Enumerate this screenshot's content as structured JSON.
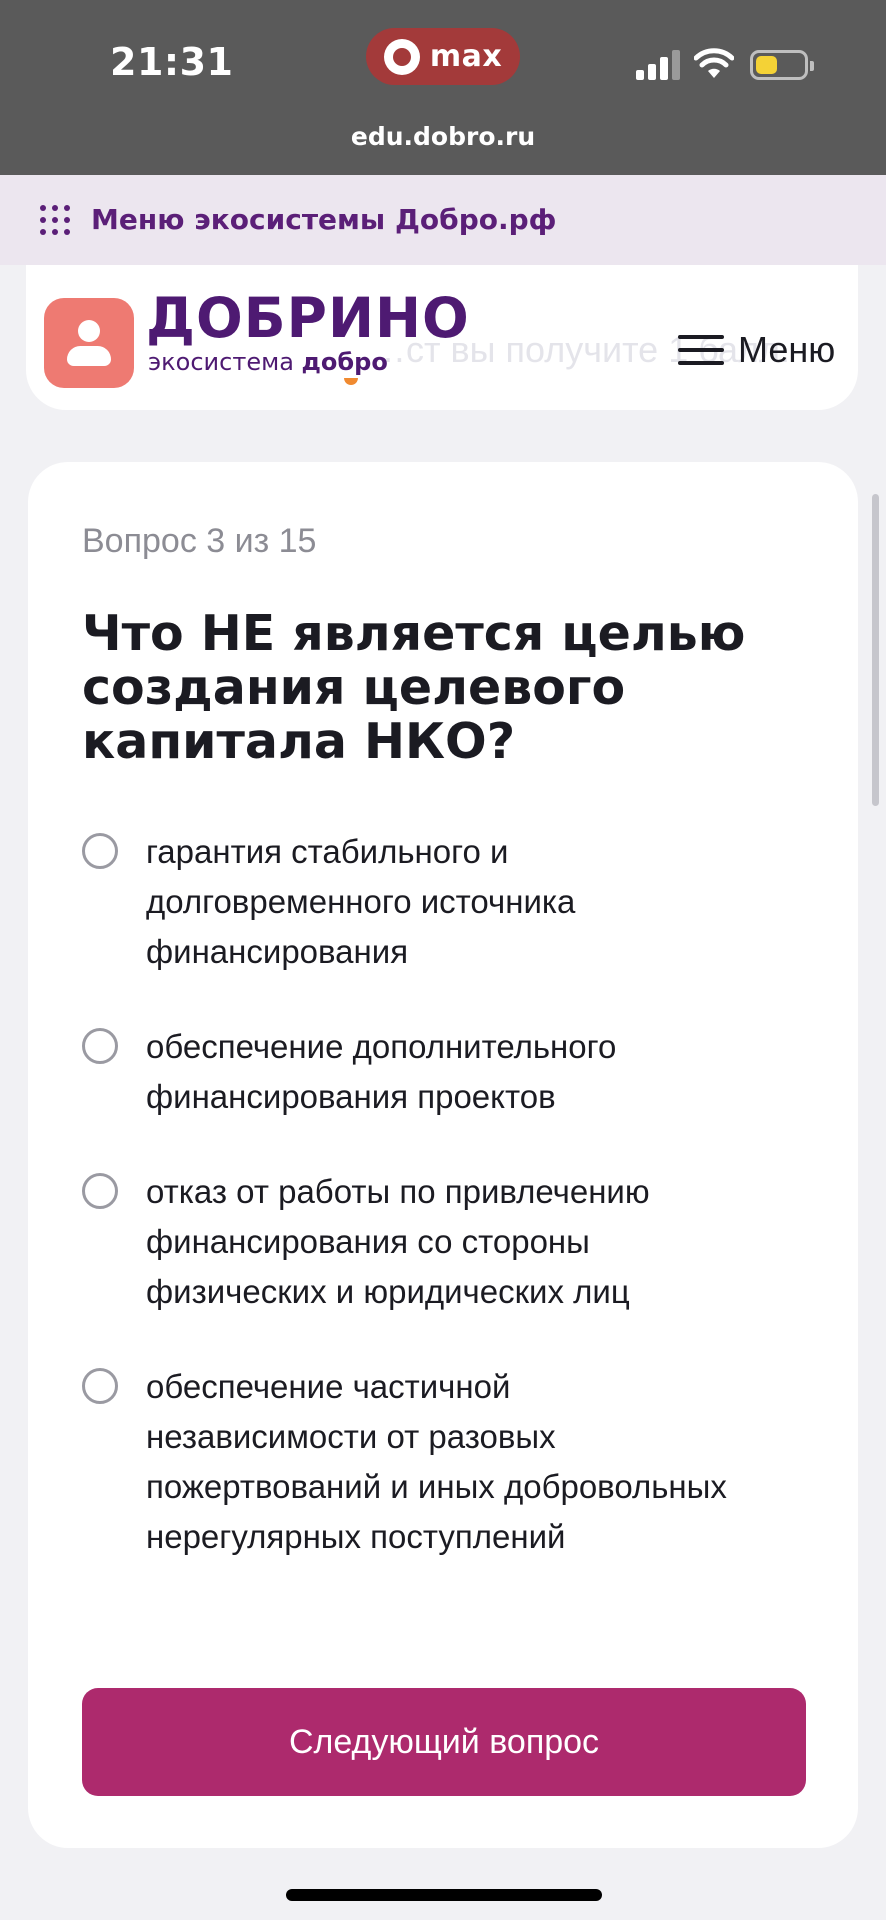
{
  "status_bar": {
    "time": "21:31",
    "messenger_app": "max",
    "url": "edu.dobro.ru",
    "battery_color": "#f4d236"
  },
  "eco_strip": {
    "label": "Меню экосистемы Добро.рф",
    "icon": "grid-dots-icon"
  },
  "header": {
    "behind_text": "…ст вы получите 1 балл.",
    "brand_name": "ДОБРИНО",
    "brand_sub_plain": "экосистема",
    "brand_sub_bold": "добро",
    "menu_label": "Меню",
    "menu_icon": "hamburger-icon"
  },
  "quiz": {
    "counter": "Вопрос 3 из 15",
    "question": "Что НЕ является целью создания целевого капитала НКО?",
    "options": [
      {
        "text": "гарантия стабильного и долговременного источника финансирования",
        "selected": false
      },
      {
        "text": "обеспечение дополнительного финансирования проектов",
        "selected": false
      },
      {
        "text": "отказ от работы по привлечению финансирования со стороны физических и юридических лиц",
        "selected": false
      },
      {
        "text": "обеспечение частичной независимости от разовых пожертвований и иных добровольных нерегулярных поступлений",
        "selected": false
      }
    ],
    "next_button": "Следующий вопрос"
  },
  "colors": {
    "brand_purple": "#4e1a72",
    "accent_button": "#ad2a6d",
    "logo_coral": "#ee7a72"
  }
}
